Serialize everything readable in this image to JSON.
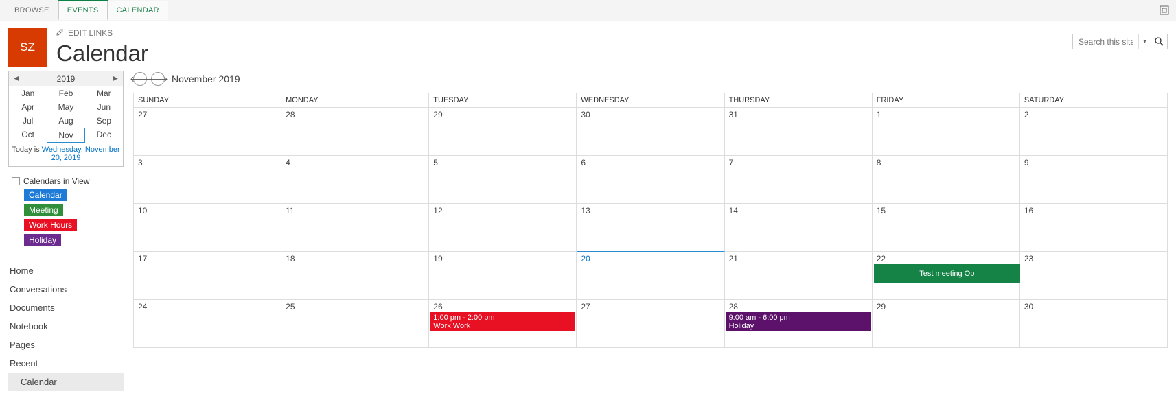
{
  "ribbon": {
    "browse": "BROWSE",
    "events": "EVENTS",
    "calendar": "CALENDAR"
  },
  "header": {
    "logo": "SZ",
    "edit_links": "EDIT LINKS",
    "title": "Calendar"
  },
  "search": {
    "placeholder": "Search this site"
  },
  "year_picker": {
    "year": "2019",
    "months": [
      "Jan",
      "Feb",
      "Mar",
      "Apr",
      "May",
      "Jun",
      "Jul",
      "Aug",
      "Sep",
      "Oct",
      "Nov",
      "Dec"
    ],
    "current_month_index": 10,
    "today_prefix": "Today is ",
    "today_date": "Wednesday, November 20, 2019"
  },
  "civ": {
    "title": "Calendars in View",
    "items": [
      "Calendar",
      "Meeting",
      "Work Hours",
      "Holiday"
    ],
    "colors": [
      "#1e7bd6",
      "#2f8f3b",
      "#e81123",
      "#6b2b8f"
    ]
  },
  "ql": {
    "items": [
      "Home",
      "Conversations",
      "Documents",
      "Notebook",
      "Pages",
      "Recent"
    ],
    "sub": "Calendar"
  },
  "cal": {
    "month_title": "November 2019",
    "dow": [
      "SUNDAY",
      "MONDAY",
      "TUESDAY",
      "WEDNESDAY",
      "THURSDAY",
      "FRIDAY",
      "SATURDAY"
    ],
    "rows": [
      [
        "27",
        "28",
        "29",
        "30",
        "31",
        "1",
        "2"
      ],
      [
        "3",
        "4",
        "5",
        "6",
        "7",
        "8",
        "9"
      ],
      [
        "10",
        "11",
        "12",
        "13",
        "14",
        "15",
        "16"
      ],
      [
        "17",
        "18",
        "19",
        "20",
        "21",
        "22",
        "23"
      ],
      [
        "24",
        "25",
        "26",
        "27",
        "28",
        "29",
        "30"
      ]
    ],
    "today_row": 3,
    "today_col": 3,
    "events": {
      "test_meeting": {
        "label": "Test meeting Op"
      },
      "workwork": {
        "time": "1:00 pm - 2:00 pm",
        "label": "Work Work"
      },
      "holiday": {
        "time": "9:00 am - 6:00 pm",
        "label": "Holiday"
      }
    }
  }
}
